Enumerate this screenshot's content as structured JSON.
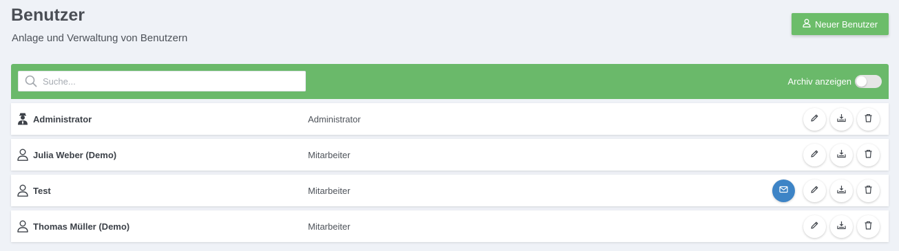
{
  "page": {
    "title": "Benutzer",
    "subtitle": "Anlage und Verwaltung von Benutzern"
  },
  "header": {
    "new_user_label": "Neuer Benutzer"
  },
  "toolbar": {
    "search_placeholder": "Suche...",
    "search_value": "",
    "archive_label": "Archiv anzeigen",
    "archive_toggle_on": false
  },
  "colors": {
    "accent_green": "#6ab96a",
    "mail_blue": "#3d84c6",
    "background": "#eff2f7"
  },
  "users": [
    {
      "name": "Administrator",
      "role": "Administrator",
      "icon": "admin-user-icon",
      "has_mail_action": false
    },
    {
      "name": "Julia Weber (Demo)",
      "role": "Mitarbeiter",
      "icon": "user-icon",
      "has_mail_action": false
    },
    {
      "name": "Test",
      "role": "Mitarbeiter",
      "icon": "user-icon",
      "has_mail_action": true
    },
    {
      "name": "Thomas Müller (Demo)",
      "role": "Mitarbeiter",
      "icon": "user-icon",
      "has_mail_action": false
    }
  ],
  "row_actions": [
    "pencil-icon",
    "download-icon",
    "trash-icon"
  ]
}
